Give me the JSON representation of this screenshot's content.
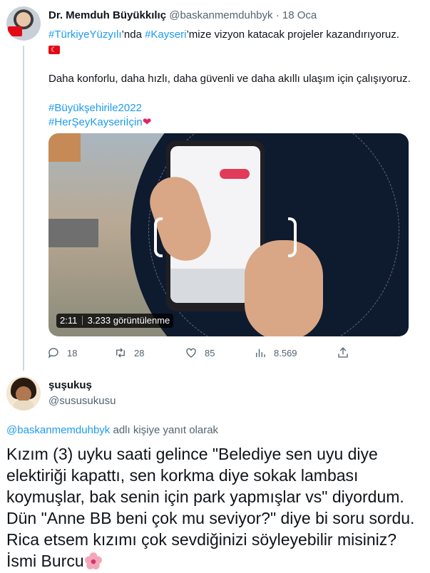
{
  "tweet": {
    "author_name": "Dr. Memduh Büyükkılıç",
    "handle": "@baskanmemduhbyk",
    "separator": "·",
    "date": "18 Oca",
    "line1_tag1": "#TürkiyeYüzyılı",
    "line1_text1": "’nda ",
    "line1_tag2": "#Kayseri",
    "line1_text2": "’mize vizyon katacak projeler kazandırıyoruz.",
    "line2": "Daha konforlu, daha hızlı, daha güvenli ve daha akıllı ulaşım için çalışıyoruz.",
    "hashtag1": "#Büyükşehirile2022",
    "hashtag2": "#HerŞeyKayseriİçin",
    "heart": "❤",
    "video": {
      "duration": "2:11",
      "views": "3.233 görüntülenme"
    },
    "actions": {
      "replies": "18",
      "retweets": "28",
      "likes": "85",
      "views": "8.569"
    }
  },
  "reply": {
    "author_name": "şuşukuş",
    "handle": "@susu﻿sukusu",
    "reply_to_handle": "@baskanmemduhbyk",
    "reply_to_text": " adlı kişiye yanıt olarak",
    "text": "Kızım (3) uyku saati gelince \"Belediye sen uyu diye elektiriği kapattı, sen korkma diye sokak lambası koymuşlar, bak senin için park yapmışlar vs\" diyordum. Dün \"Anne BB beni çok mu seviyor?\" diye bi soru sordu. Rica etsem kızımı çok sevdiğinizi söyleyebilir misiniz? İsmi Burcu"
  },
  "colors": {
    "link": "#1d9bf0",
    "secondary_text": "#536471",
    "heart": "#e0245e"
  }
}
